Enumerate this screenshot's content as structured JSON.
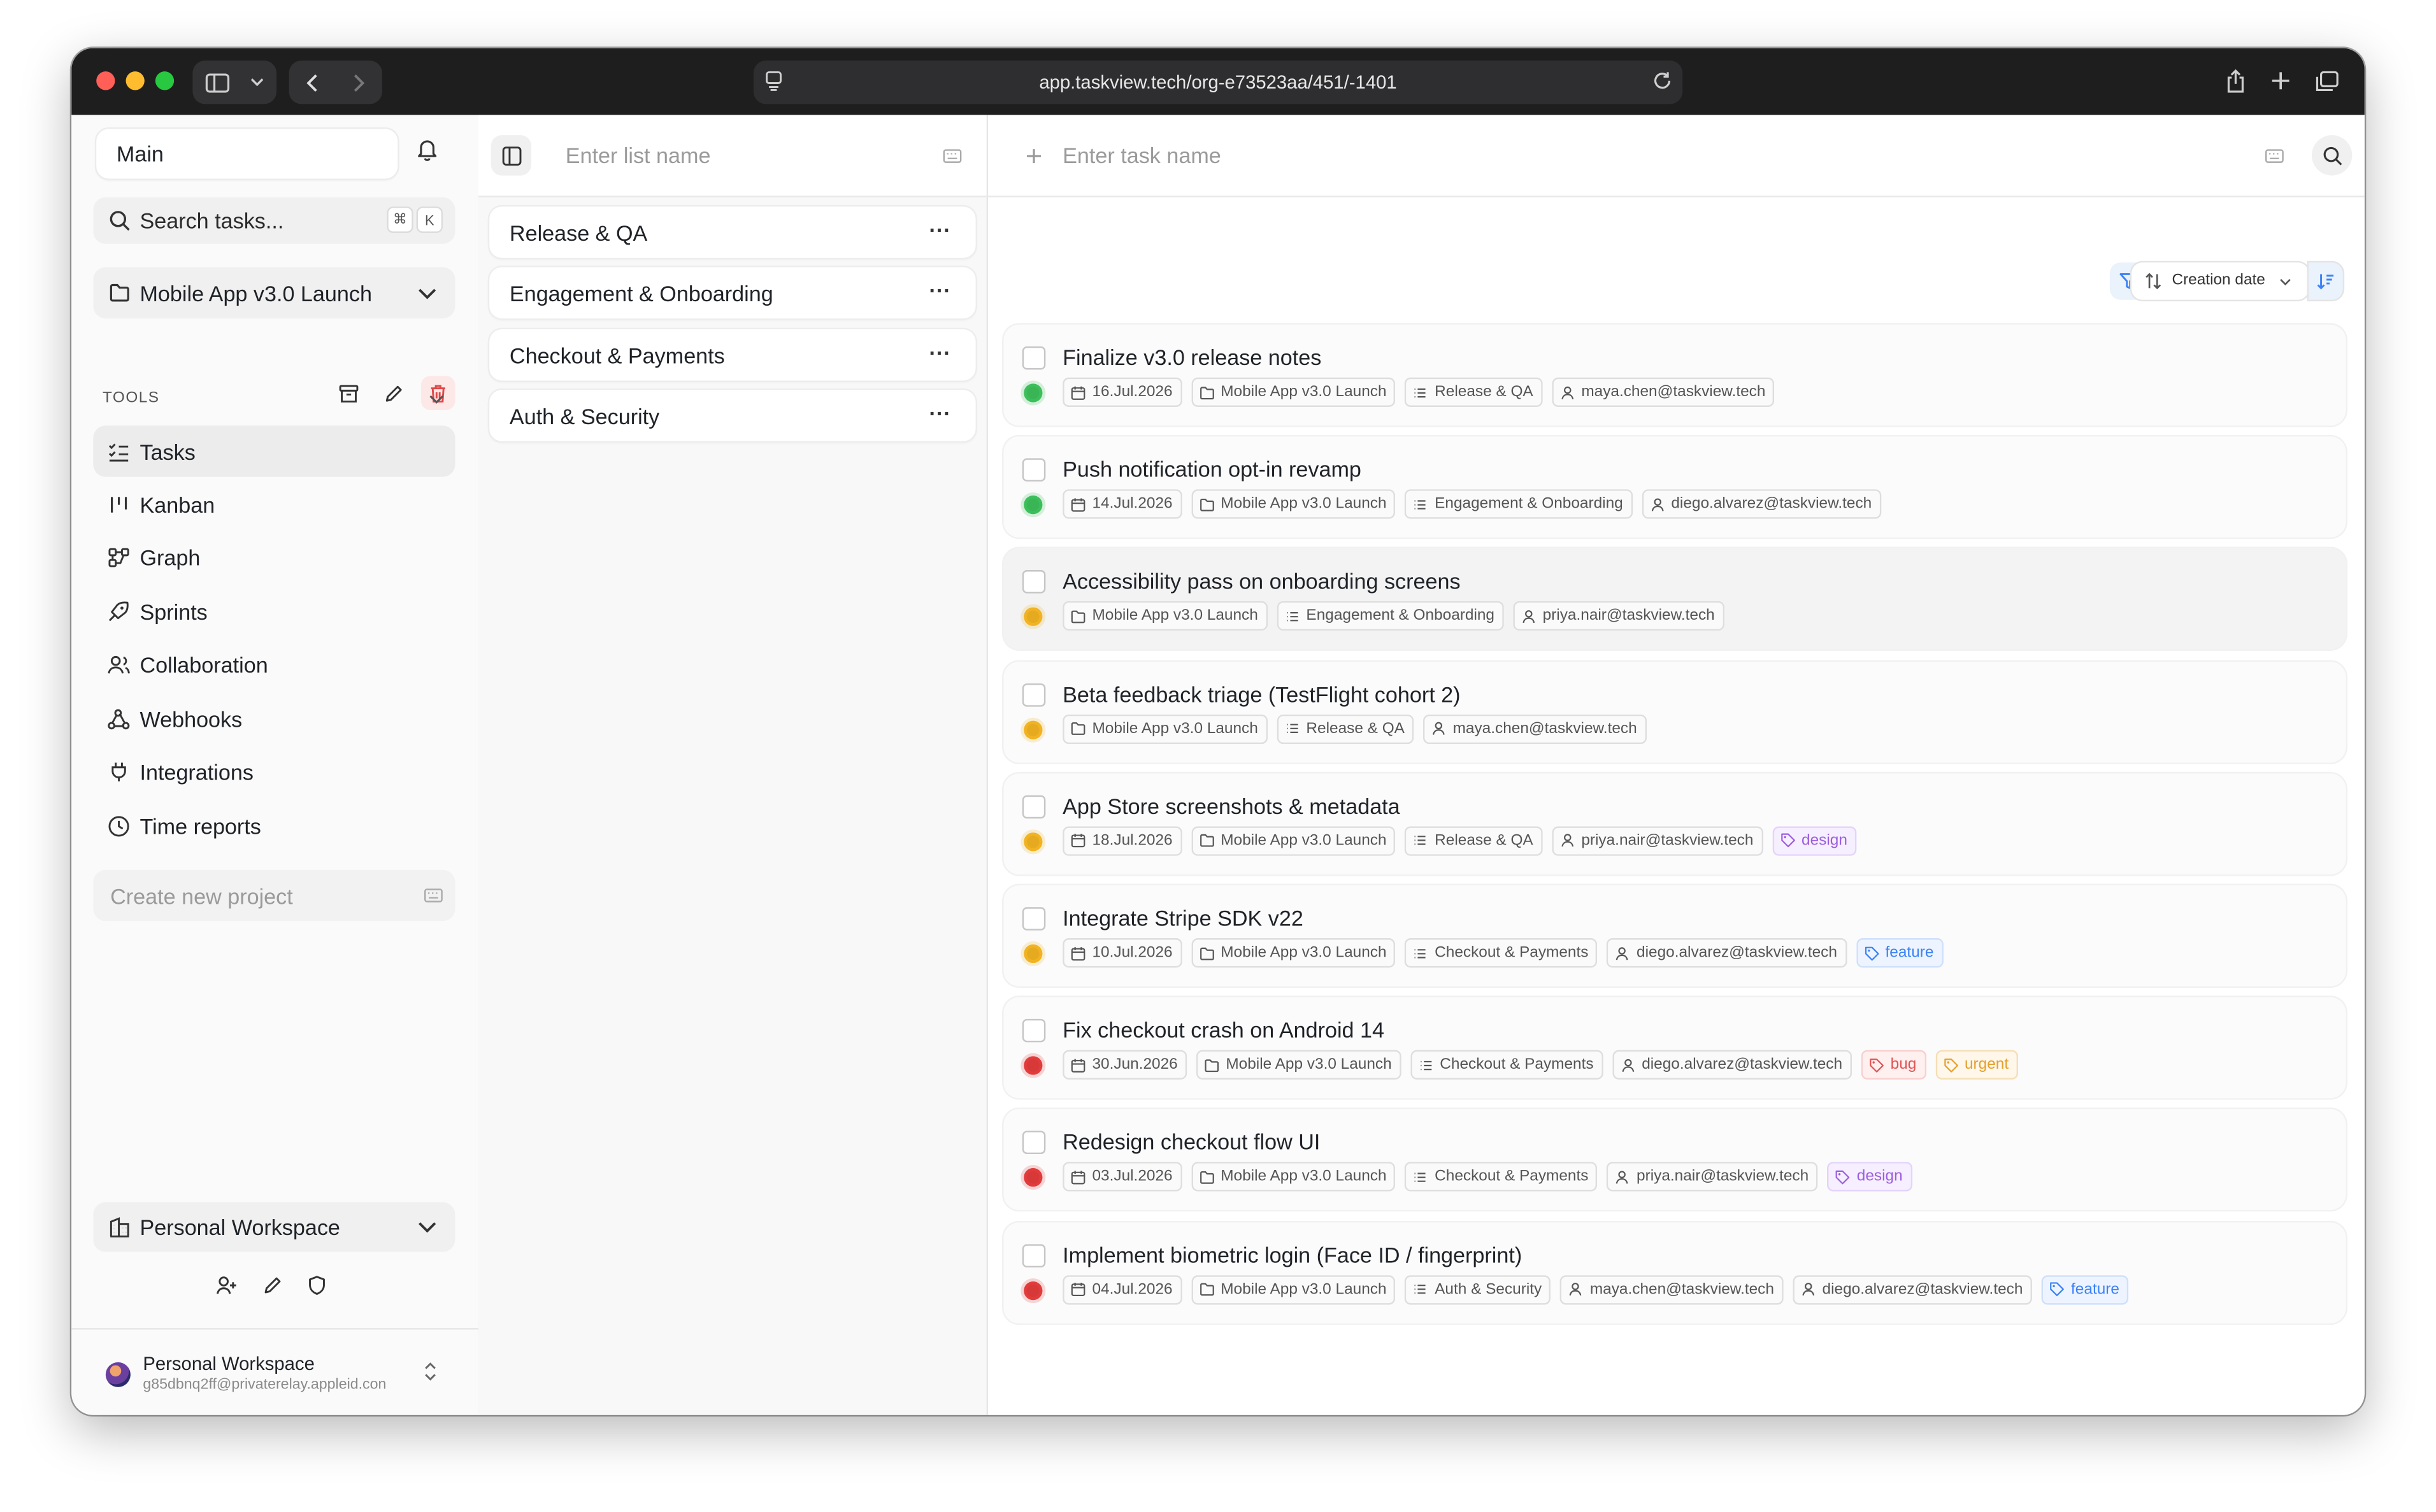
{
  "browser": {
    "url": "app.taskview.tech/org-e73523aa/451/-1401"
  },
  "sidebar": {
    "workspace_selector": "Main",
    "search_placeholder": "Search tasks...",
    "search_shortcut": [
      "⌘",
      "K"
    ],
    "project_selector": "Mobile App v3.0 Launch",
    "tools_label": "TOOLS",
    "nav": [
      {
        "label": "Tasks",
        "icon": "tasks-icon",
        "active": true
      },
      {
        "label": "Kanban",
        "icon": "kanban-icon"
      },
      {
        "label": "Graph",
        "icon": "graph-icon"
      },
      {
        "label": "Sprints",
        "icon": "rocket-icon"
      },
      {
        "label": "Collaboration",
        "icon": "users-icon"
      },
      {
        "label": "Webhooks",
        "icon": "webhook-icon"
      },
      {
        "label": "Integrations",
        "icon": "plug-icon"
      },
      {
        "label": "Time reports",
        "icon": "clock-icon"
      }
    ],
    "create_project_placeholder": "Create new project",
    "workspace_bottom": "Personal Workspace",
    "user": {
      "name": "Personal Workspace",
      "email": "g85dbnq2ff@privaterelay.appleid.con"
    }
  },
  "lists": {
    "new_list_placeholder": "Enter list name",
    "items": [
      {
        "label": "Release & QA"
      },
      {
        "label": "Engagement & Onboarding"
      },
      {
        "label": "Checkout & Payments"
      },
      {
        "label": "Auth & Security"
      }
    ]
  },
  "tasks": {
    "new_task_placeholder": "Enter task name",
    "sort_label": "Creation date",
    "colors": {
      "green": "#3cbf5a",
      "yellow": "#f2b322",
      "red": "#e23b3b"
    },
    "items": [
      {
        "title": "Finalize v3.0 release notes",
        "status_color": "#3cbf5a",
        "chips": [
          {
            "type": "date",
            "text": "16.Jul.2026"
          },
          {
            "type": "project",
            "text": "Mobile App v3.0 Launch"
          },
          {
            "type": "list",
            "text": "Release & QA"
          },
          {
            "type": "user",
            "text": "maya.chen@taskview.tech"
          }
        ]
      },
      {
        "title": "Push notification opt-in revamp",
        "status_color": "#3cbf5a",
        "chips": [
          {
            "type": "date",
            "text": "14.Jul.2026"
          },
          {
            "type": "project",
            "text": "Mobile App v3.0 Launch"
          },
          {
            "type": "list",
            "text": "Engagement & Onboarding"
          },
          {
            "type": "user",
            "text": "diego.alvarez@taskview.tech"
          }
        ]
      },
      {
        "title": "Accessibility pass on onboarding screens",
        "status_color": "#f2b322",
        "highlight": true,
        "chips": [
          {
            "type": "project",
            "text": "Mobile App v3.0 Launch"
          },
          {
            "type": "list",
            "text": "Engagement & Onboarding"
          },
          {
            "type": "user",
            "text": "priya.nair@taskview.tech"
          }
        ]
      },
      {
        "title": "Beta feedback triage (TestFlight cohort 2)",
        "status_color": "#f2b322",
        "chips": [
          {
            "type": "project",
            "text": "Mobile App v3.0 Launch"
          },
          {
            "type": "list",
            "text": "Release & QA"
          },
          {
            "type": "user",
            "text": "maya.chen@taskview.tech"
          }
        ]
      },
      {
        "title": "App Store screenshots & metadata",
        "status_color": "#f2b322",
        "chips": [
          {
            "type": "date",
            "text": "18.Jul.2026"
          },
          {
            "type": "project",
            "text": "Mobile App v3.0 Launch"
          },
          {
            "type": "list",
            "text": "Release & QA"
          },
          {
            "type": "user",
            "text": "priya.nair@taskview.tech"
          },
          {
            "type": "tag-design",
            "text": "design"
          }
        ]
      },
      {
        "title": "Integrate Stripe SDK v22",
        "status_color": "#f2b322",
        "chips": [
          {
            "type": "date",
            "text": "10.Jul.2026"
          },
          {
            "type": "project",
            "text": "Mobile App v3.0 Launch"
          },
          {
            "type": "list",
            "text": "Checkout & Payments"
          },
          {
            "type": "user",
            "text": "diego.alvarez@taskview.tech"
          },
          {
            "type": "tag-feature",
            "text": "feature"
          }
        ]
      },
      {
        "title": "Fix checkout crash on Android 14",
        "status_color": "#e23b3b",
        "chips": [
          {
            "type": "date",
            "text": "30.Jun.2026"
          },
          {
            "type": "project",
            "text": "Mobile App v3.0 Launch"
          },
          {
            "type": "list",
            "text": "Checkout & Payments"
          },
          {
            "type": "user",
            "text": "diego.alvarez@taskview.tech"
          },
          {
            "type": "tag-bug",
            "text": "bug"
          },
          {
            "type": "tag-urgent",
            "text": "urgent"
          }
        ]
      },
      {
        "title": "Redesign checkout flow UI",
        "status_color": "#e23b3b",
        "chips": [
          {
            "type": "date",
            "text": "03.Jul.2026"
          },
          {
            "type": "project",
            "text": "Mobile App v3.0 Launch"
          },
          {
            "type": "list",
            "text": "Checkout & Payments"
          },
          {
            "type": "user",
            "text": "priya.nair@taskview.tech"
          },
          {
            "type": "tag-design",
            "text": "design"
          }
        ]
      },
      {
        "title": "Implement biometric login (Face ID / fingerprint)",
        "status_color": "#e23b3b",
        "chips": [
          {
            "type": "date",
            "text": "04.Jul.2026"
          },
          {
            "type": "project",
            "text": "Mobile App v3.0 Launch"
          },
          {
            "type": "list",
            "text": "Auth & Security"
          },
          {
            "type": "user",
            "text": "maya.chen@taskview.tech"
          },
          {
            "type": "user",
            "text": "diego.alvarez@taskview.tech"
          },
          {
            "type": "tag-feature",
            "text": "feature"
          }
        ]
      }
    ]
  }
}
